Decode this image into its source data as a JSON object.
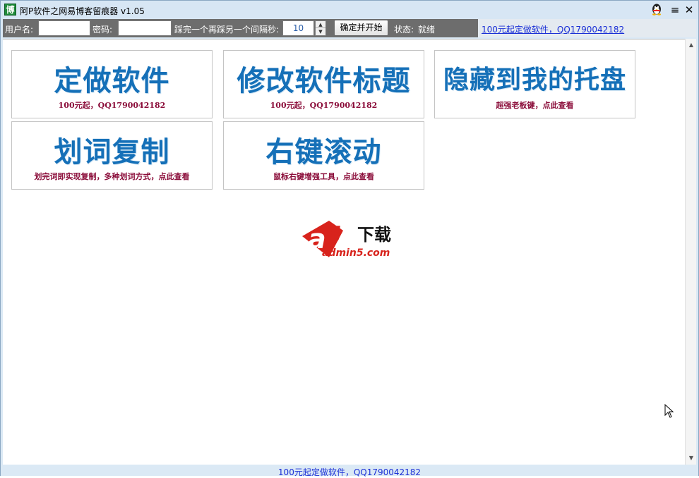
{
  "window": {
    "title": "阿P软件之网易博客留痕器 v1.05",
    "app_icon_glyph": "博"
  },
  "toolbar": {
    "username_label": "用户名:",
    "username_value": "",
    "password_label": "密码:",
    "password_value": "",
    "interval_label": "踩完一个再踩另一个间隔秒:",
    "interval_value": "10",
    "start_button": "确定并开始",
    "status_label": "状态:",
    "status_value": "就绪",
    "promo_link": "100元起定做软件，QQ1790042182"
  },
  "cards": [
    {
      "title": "定做软件",
      "subtitle": "100元起，QQ1790042182"
    },
    {
      "title": "修改软件标题",
      "subtitle": "100元起，QQ1790042182"
    },
    {
      "title": "隐藏到我的托盘",
      "subtitle": "超强老板键，点此查看"
    },
    {
      "title": "划词复制",
      "subtitle": "划完词即实现复制，多种划词方式，点此查看"
    },
    {
      "title": "右键滚动",
      "subtitle": "鼠标右键增强工具，点此查看"
    }
  ],
  "logo": {
    "letter_a": "a",
    "digit": "5",
    "text_cn": "下载",
    "domain": "admin5.com"
  },
  "statusbar": {
    "text": "100元起定做软件，QQ1790042182"
  },
  "colors": {
    "card_title": "#1570b8",
    "card_subtitle": "#8b0d3a",
    "link": "#1a2fd6",
    "toolbar_bg": "#6d6d6d",
    "logo_red": "#d8231c"
  },
  "icons": {
    "qq": "qq-penguin-icon",
    "menu": "menu-icon",
    "close": "close-icon"
  }
}
